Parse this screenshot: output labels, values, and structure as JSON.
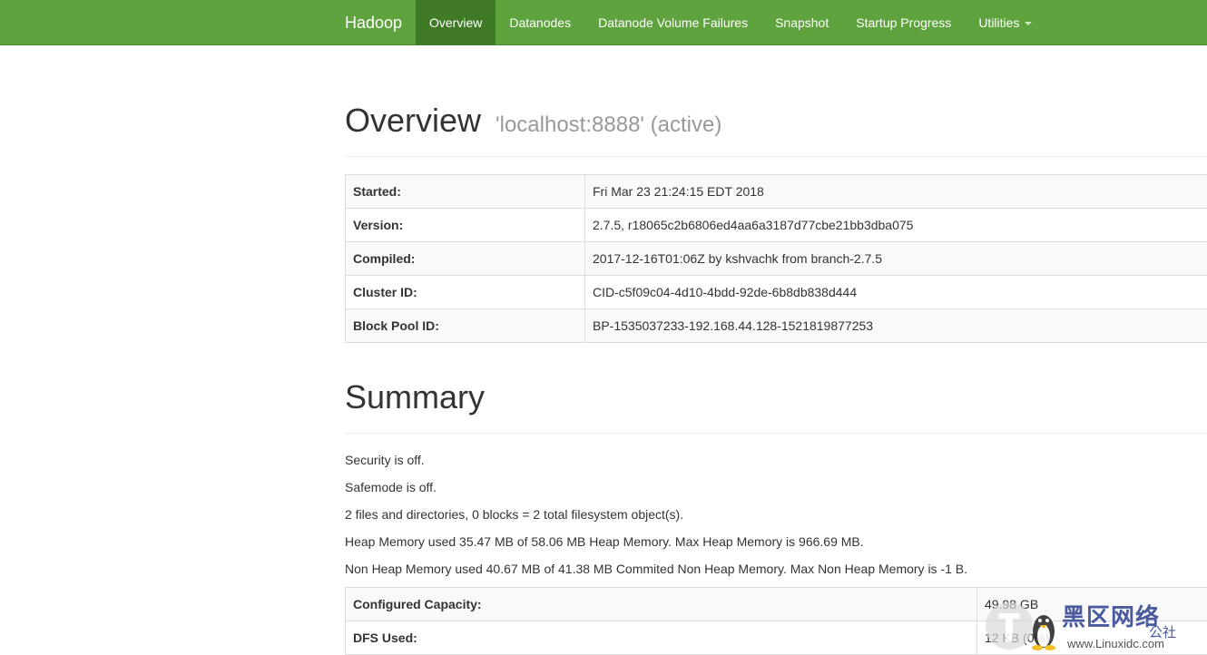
{
  "navbar": {
    "brand": "Hadoop",
    "items": [
      {
        "label": "Overview",
        "active": true
      },
      {
        "label": "Datanodes",
        "active": false
      },
      {
        "label": "Datanode Volume Failures",
        "active": false
      },
      {
        "label": "Snapshot",
        "active": false
      },
      {
        "label": "Startup Progress",
        "active": false
      },
      {
        "label": "Utilities",
        "active": false,
        "dropdown": true
      }
    ],
    "color": "#5fa33e",
    "active_color": "#3f7a27"
  },
  "overview": {
    "title": "Overview",
    "subtitle": "'localhost:8888' (active)",
    "rows": [
      {
        "label": "Started:",
        "value": "Fri Mar 23 21:24:15 EDT 2018"
      },
      {
        "label": "Version:",
        "value": "2.7.5, r18065c2b6806ed4aa6a3187d77cbe21bb3dba075"
      },
      {
        "label": "Compiled:",
        "value": "2017-12-16T01:06Z by kshvachk from branch-2.7.5"
      },
      {
        "label": "Cluster ID:",
        "value": "CID-c5f09c04-4d10-4bdd-92de-6b8db838d444"
      },
      {
        "label": "Block Pool ID:",
        "value": "BP-1535037233-192.168.44.128-1521819877253"
      }
    ]
  },
  "summary": {
    "title": "Summary",
    "lines": [
      "Security is off.",
      "Safemode is off.",
      "2 files and directories, 0 blocks = 2 total filesystem object(s).",
      "Heap Memory used 35.47 MB of 58.06 MB Heap Memory. Max Heap Memory is 966.69 MB.",
      "Non Heap Memory used 40.67 MB of 41.38 MB Commited Non Heap Memory. Max Non Heap Memory is -1 B."
    ],
    "rows": [
      {
        "label": "Configured Capacity:",
        "value": "49.98 GB"
      },
      {
        "label": "DFS Used:",
        "value": "12 KB (0%)"
      }
    ]
  },
  "watermark": {
    "title": "黑区网络",
    "sub": "公社",
    "url": "www.Linuxidc.com",
    "icon": "penguin-icon"
  }
}
